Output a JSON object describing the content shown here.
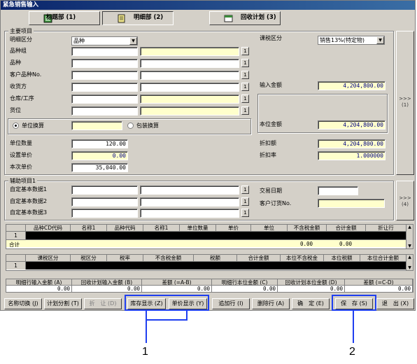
{
  "window": {
    "title": "紧急销售输入"
  },
  "tabs": [
    {
      "label": "标题部 (1)"
    },
    {
      "label": "明细部 (2)"
    },
    {
      "label": "回收计划 (3)"
    }
  ],
  "main_group": {
    "title": "主要项目",
    "detail_class_label": "明细区分",
    "detail_class_value": "品种",
    "tax_class_label": "课税区分",
    "tax_class_value": "销售13%(特定物)",
    "rows": [
      {
        "label": "品种组",
        "btn": "1"
      },
      {
        "label": "品种",
        "btn": "1"
      },
      {
        "label": "客户品种No.",
        "btn": "1"
      },
      {
        "label": "收货方",
        "btn": "1"
      },
      {
        "label": "仓库/工序",
        "btn": "1"
      },
      {
        "label": "货位",
        "btn": "1"
      }
    ],
    "input_amount_label": "输入金额",
    "input_amount_value": "4,204,800.00",
    "base_amount_label": "本位金额",
    "base_amount_value": "4,204,800.00",
    "unit_convert_label": "单位换算",
    "pack_convert_label": "包装换算",
    "unit_qty_label": "单位数量",
    "unit_qty_value": "120.00",
    "set_price_label": "设置单价",
    "set_price_value": "0.00",
    "this_price_label": "本次单价",
    "this_price_value": "35,040.00",
    "discount_label": "折扣额",
    "discount_value": "4,204,800.00",
    "discount_rate_label": "折扣率",
    "discount_rate_value": "1.000000",
    "side_label": "(1)"
  },
  "aux_group": {
    "title": "辅助项目1",
    "rows": [
      {
        "label": "自定基本数据1",
        "btn": "1"
      },
      {
        "label": "自定基本数据2",
        "btn": "1"
      },
      {
        "label": "自定基本数据3",
        "btn": "1"
      }
    ],
    "trade_date_label": "交易日期",
    "customer_order_label": "客户订货No.",
    "side_label": "(4)"
  },
  "grid1": {
    "headers": [
      "品种CD代码",
      "名称1",
      "品种代码",
      "名称1",
      "单位数量",
      "单价",
      "单位",
      "不含税金额",
      "合计金额",
      "折让行"
    ],
    "row_no": "1",
    "total_label": "合计",
    "total_values": [
      "0.00",
      "0.00"
    ]
  },
  "grid2": {
    "headers": [
      "课税区分",
      "税区分",
      "税率",
      "不含税金额",
      "税额",
      "合计金额",
      "本位不含税金",
      "本位税额",
      "本位合计金额"
    ],
    "row_no": "1"
  },
  "summary": {
    "headers": [
      "明细行输入金额 (A)",
      "回收计划输入金额 (B)",
      "差额 (=A-B)",
      "明细行本位金额 (C)",
      "回收计划本位金额 (D)",
      "差额 (=C-D)"
    ],
    "values": [
      "0.00",
      "0.00",
      "0.00",
      "0.00",
      "0.00",
      "0.00"
    ]
  },
  "buttons": {
    "name_switch": "名称切换 (J)",
    "plan_split": "计划分割 (T)",
    "discount": "折　让 (D)",
    "stock_show": "库存显示 (Z)",
    "price_show": "单价显示 (Y)",
    "add_row": "追加行 (I)",
    "delete_row": "删除行 (A)",
    "confirm": "确　定 (E)",
    "save": "保　存 (S)",
    "exit": "退　出 (X)"
  },
  "callouts": {
    "one": "1",
    "two": "2"
  }
}
